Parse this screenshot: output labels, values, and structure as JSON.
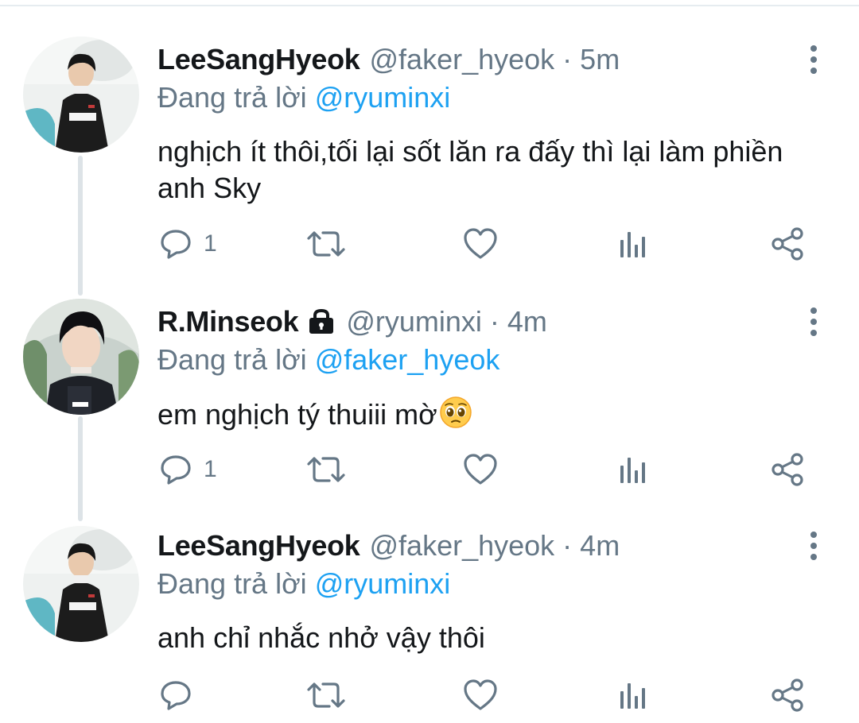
{
  "tweets": [
    {
      "name": "LeeSangHyeok",
      "handle": "@faker_hyeok",
      "separator": "·",
      "time": "5m",
      "reply_prefix": "Đang trả lời",
      "reply_to": "@ryuminxi",
      "text": "nghịch ít thôi,tối lại sốt lăn ra đấy thì lại làm phiền anh Sky",
      "reply_count": "1",
      "locked": false
    },
    {
      "name": "R.Minseok",
      "handle": "@ryuminxi",
      "separator": "·",
      "time": "4m",
      "reply_prefix": "Đang trả lời",
      "reply_to": "@faker_hyeok",
      "text": "em nghịch tý thuiii mờ",
      "reply_count": "1",
      "locked": true
    },
    {
      "name": "LeeSangHyeok",
      "handle": "@faker_hyeok",
      "separator": "·",
      "time": "4m",
      "reply_prefix": "Đang trả lời",
      "reply_to": "@ryuminxi",
      "text": "anh chỉ nhắc nhở vậy thôi",
      "reply_count": "",
      "locked": false
    }
  ],
  "icons": {
    "reply": "speech-bubble-icon",
    "retweet": "retweet-icon",
    "like": "heart-icon",
    "analytics": "bar-chart-icon",
    "share": "share-icon",
    "more": "more-vertical-icon",
    "lock": "lock-icon",
    "emoji": "pleading-face-emoji"
  },
  "colors": {
    "link": "#1da1f2",
    "muted": "#657786",
    "text": "#14171a",
    "thread_line": "#dde3e7"
  }
}
